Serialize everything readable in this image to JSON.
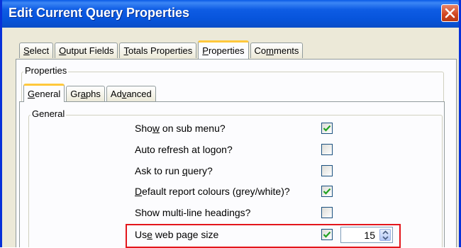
{
  "window": {
    "title": "Edit Current Query Properties"
  },
  "outer_tabs": [
    {
      "pre": "",
      "key": "S",
      "post": "elect"
    },
    {
      "pre": "",
      "key": "O",
      "post": "utput Fields"
    },
    {
      "pre": "",
      "key": "T",
      "post": "otals Properties"
    },
    {
      "pre": "",
      "key": "P",
      "post": "roperties"
    },
    {
      "pre": "Co",
      "key": "m",
      "post": "ments"
    }
  ],
  "outer_group": {
    "label": "Properties"
  },
  "inner_tabs": [
    {
      "pre": "",
      "key": "G",
      "post": "eneral"
    },
    {
      "pre": "Gr",
      "key": "a",
      "post": "phs"
    },
    {
      "pre": "Ad",
      "key": "v",
      "post": "anced"
    }
  ],
  "inner_group": {
    "label": "General"
  },
  "options": [
    {
      "pre": "Sho",
      "key": "w",
      "post": " on sub menu?",
      "checked": true
    },
    {
      "pre": "Auto refresh at logon?",
      "key": "",
      "post": "",
      "checked": false
    },
    {
      "pre": "Ask to run ",
      "key": "q",
      "post": "uery?",
      "checked": false
    },
    {
      "pre": "",
      "key": "D",
      "post": "efault report colours (grey/white)?",
      "checked": true
    },
    {
      "pre": "Show multi-line headings?",
      "key": "",
      "post": "",
      "checked": false
    },
    {
      "pre": "Us",
      "key": "e",
      "post": " web page size",
      "checked": true
    }
  ],
  "page_size": {
    "value": "15"
  },
  "colors": {
    "highlight": "#e3161c",
    "titlebar": "#0a5ae6",
    "tab_accent": "#ffc83c"
  }
}
